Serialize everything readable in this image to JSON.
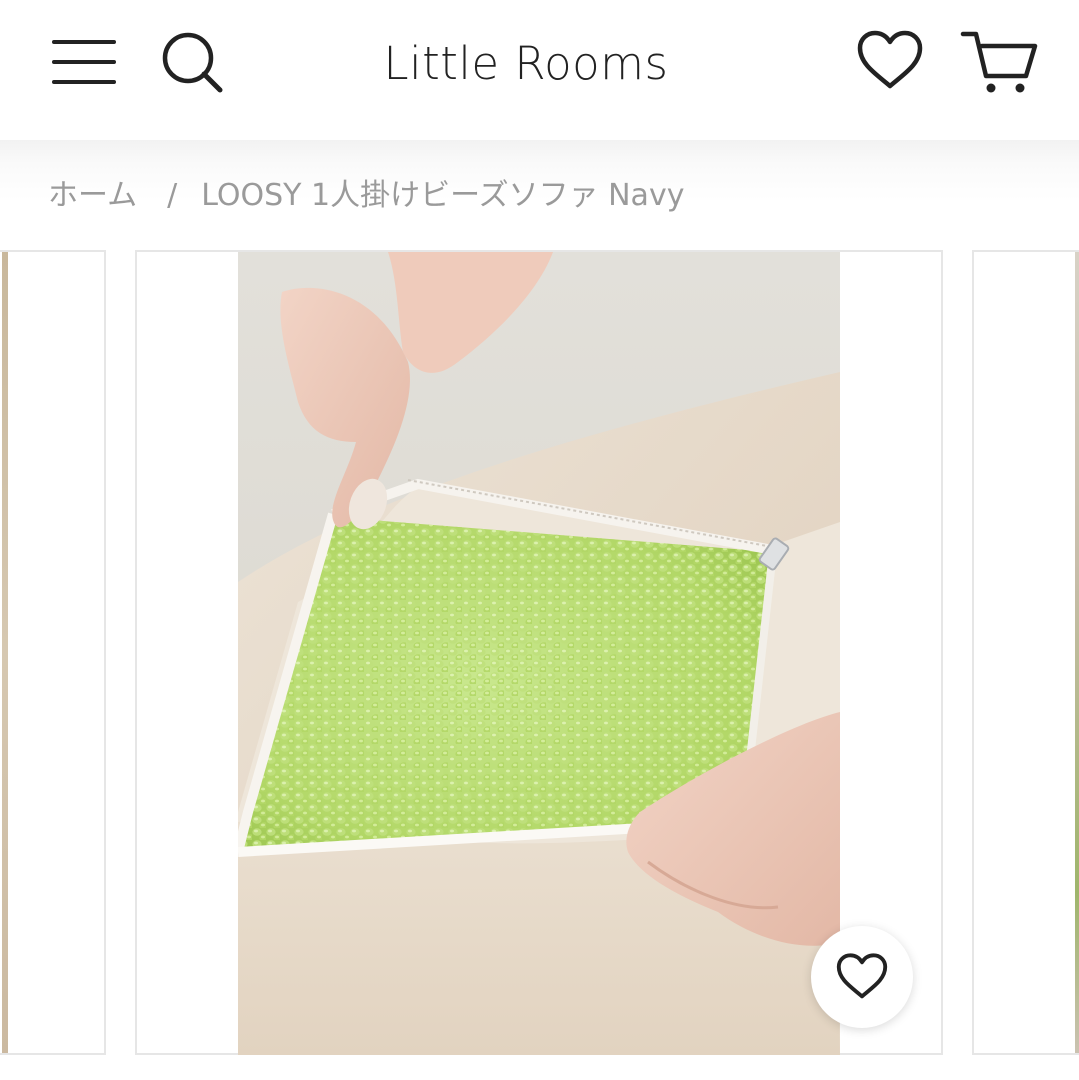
{
  "header": {
    "logo_text": "Little Rooms",
    "icons": {
      "menu": "hamburger-menu-icon",
      "search": "search-icon",
      "wishlist": "heart-icon",
      "cart": "cart-icon"
    }
  },
  "breadcrumb": {
    "home": "ホーム",
    "separator": "/",
    "current": "LOOSY 1人掛けビーズソファ Navy"
  },
  "gallery": {
    "main_image": "product-photo-beads-filling",
    "favorite_icon": "heart-icon"
  },
  "colors": {
    "text_dark": "#222222",
    "breadcrumb_gray": "#9a9a9a",
    "bead_green": "#b8dd72",
    "fabric_beige": "#e5d8c8"
  }
}
